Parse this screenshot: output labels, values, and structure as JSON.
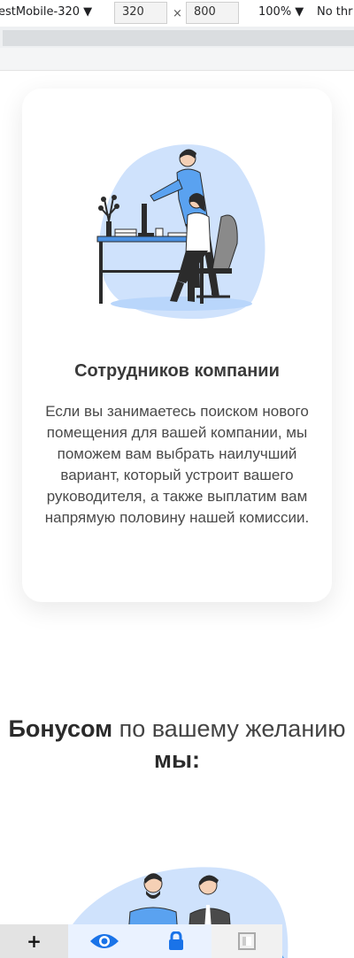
{
  "devtools": {
    "device": "estMobile-320 ▼",
    "width": "320",
    "height": "800",
    "times": "×",
    "zoom": "100% ▼",
    "throttle": "No thr"
  },
  "card": {
    "title": "Сотрудников компании",
    "text": "Если вы занимаетесь поиском нового помещения для вашей компании, мы поможем вам выбрать наилучший вариант, который устроит вашего руководителя, а также выплатим вам напрямую половину нашей комиссии."
  },
  "section": {
    "title_bold_1": "Бонусом",
    "title_normal": " по вашему желанию ",
    "title_bold_2": "мы:"
  },
  "bottom_bar": {
    "plus": "+",
    "icons": [
      "eye-icon",
      "lock-icon",
      "extension-icon"
    ]
  },
  "colors": {
    "accent_blue": "#1a73e8",
    "illustration_blue": "#cfe2fc",
    "shirt_blue": "#5aa2f0"
  }
}
